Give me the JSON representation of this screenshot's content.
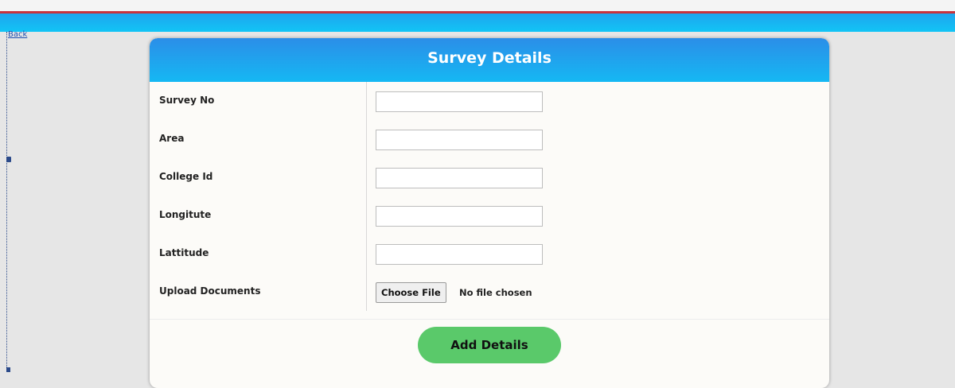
{
  "nav": {
    "back_label": "Back"
  },
  "form": {
    "title": "Survey Details",
    "fields": [
      {
        "label": "Survey No",
        "value": "",
        "placeholder": ""
      },
      {
        "label": "Area",
        "value": "",
        "placeholder": ""
      },
      {
        "label": "College Id",
        "value": "",
        "placeholder": ""
      },
      {
        "label": "Longitute",
        "value": "",
        "placeholder": ""
      },
      {
        "label": "Lattitude",
        "value": "",
        "placeholder": ""
      }
    ],
    "upload": {
      "label": "Upload Documents",
      "button_label": "Choose File",
      "status": "No file chosen"
    },
    "submit_label": "Add Details"
  },
  "colors": {
    "header_gradient_start": "#2b8ee8",
    "header_gradient_end": "#15b8f3",
    "submit_button": "#5ac96a",
    "top_red_line": "#c8323c",
    "card_background": "#fcfbf8"
  }
}
